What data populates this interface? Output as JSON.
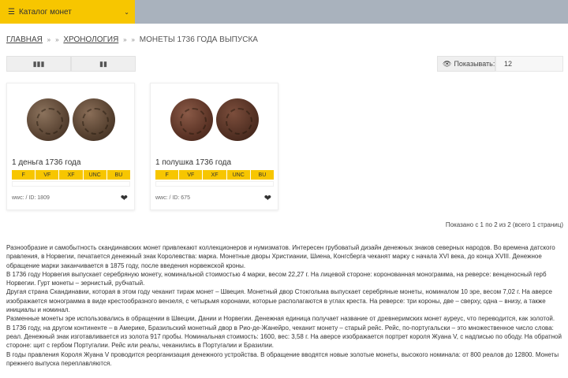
{
  "header": {
    "catalog_label": "Каталог монет",
    "catalog_icon": "hamburger-icon",
    "dropdown_icon": "chevron-down-icon"
  },
  "breadcrumb": {
    "home": "ГЛАВНАЯ",
    "chronology": "ХРОНОЛОГИЯ",
    "current": "МОНЕТЫ 1736 ГОДА ВЫПУСКА",
    "separator": "»"
  },
  "view_toggle": {
    "grid_icon": "grid-view-icon",
    "list_icon": "list-view-icon"
  },
  "show_per_page": {
    "label": "Показывать:",
    "value": "12"
  },
  "coins": [
    {
      "title": "1 деньга 1736 года",
      "grades": [
        "F",
        "VF",
        "XF",
        "UNC",
        "BU"
      ],
      "meta": "wwc: / ID: 1809"
    },
    {
      "title": "1 полушка 1736 года",
      "grades": [
        "F",
        "VF",
        "XF",
        "UNC",
        "BU"
      ],
      "meta": "wwc: / ID: 675"
    }
  ],
  "pager_info": "Показано с 1 по 2 из 2 (всего 1 страниц)",
  "description": [
    "Разнообразие и самобытность скандинавских монет привлекают коллекционеров и нумизматов. Интересен грубоватый дизайн денежных знаков северных народов. Во времена датского правления, в Норвегии, печатается денежный знак Королевства: марка. Монетные дворы Христиании, Шиена, Конгсберга чеканят марку с начала XVI века, до конца XVIII. Денежное обращение марки заканчивается в 1875 году, после введения норвежской кроны.",
    "В 1736 году Норвегия выпускает серебряную монету, номинальной стоимостью 4 марки, весом 22,27 г. На лицевой стороне: коронованная монограмма, на реверсе: венценосный герб Норвегии. Гурт монеты – зернистый, рубчатый.",
    "Другая страна Скандинавии, которая в этом году чеканит тираж монет – Швеция. Монетный двор Стокгольма выпускает серебряные монеты, номиналом 10 эре, весом 7,02 г. На аверсе изображается монограмма в виде крестообразного вензеля, с четырьмя коронами, которые располагаются в углах креста. На реверсе: три короны, две – сверху, одна – внизу, а также инициалы и номинал.",
    "Разменные монеты эре использовались в обращении в Швеции, Дании и Норвегии. Денежная единица получает название от древнеримских монет ауреус, что переводится, как золотой.",
    "В 1736 году, на другом континенте – в Америке, Бразильский монетный двор в Рио-де-Жанейро, чеканит монету – старый рейс. Рейс, по-португальски – это множественное число слова: реал. Денежный знак изготавливается из золота 917 пробы. Номинальная стоимость: 1600, вес: 3,58 г. На аверсе изображается портрет короля Жуана V, с надписью по ободу. На обратной стороне: щит с гербом Португалии. Рейс или реалы, чеканились в Португалии и Бразилии.",
    "В годы правления Короля Жуана V проводится реорганизация денежного устройства. В обращение вводятся новые золотые монеты, высокого номинала: от 800 реалов до 12800. Монеты прежнего выпуска переплавляются."
  ]
}
